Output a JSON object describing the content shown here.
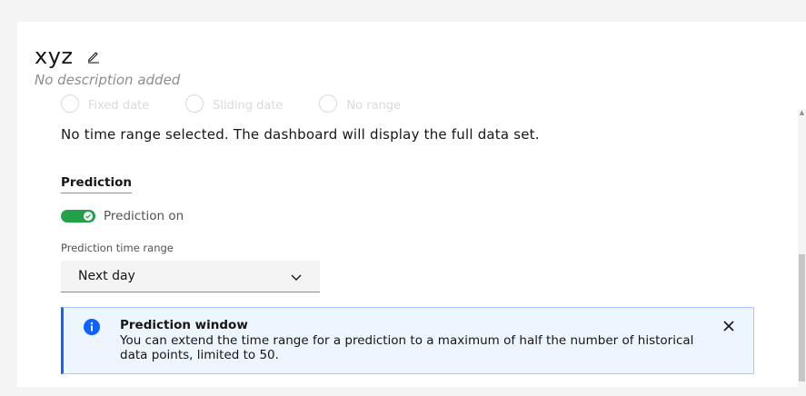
{
  "header": {
    "title": "xyz",
    "description": "No description added"
  },
  "time_range": {
    "radio_options": [
      "Fixed date",
      "Sliding date",
      "No range"
    ],
    "info_text": "No time range selected. The dashboard will display the full data set."
  },
  "prediction": {
    "heading": "Prediction",
    "toggle_label": "Prediction on",
    "toggle_on": true,
    "field_label": "Prediction time range",
    "selected_value": "Next day"
  },
  "notification": {
    "title": "Prediction window",
    "body": "You can extend the time range for a prediction to a maximum of half the number of historical data points, limited to 50."
  },
  "colors": {
    "toggle_on": "#24a148",
    "info_accent": "#0f62fe",
    "info_background": "#edf5ff"
  },
  "icons": {
    "edit": "pencil-icon",
    "info": "info-icon",
    "close": "close-icon",
    "select": "chevron-down-icon",
    "check": "checkmark-icon"
  }
}
